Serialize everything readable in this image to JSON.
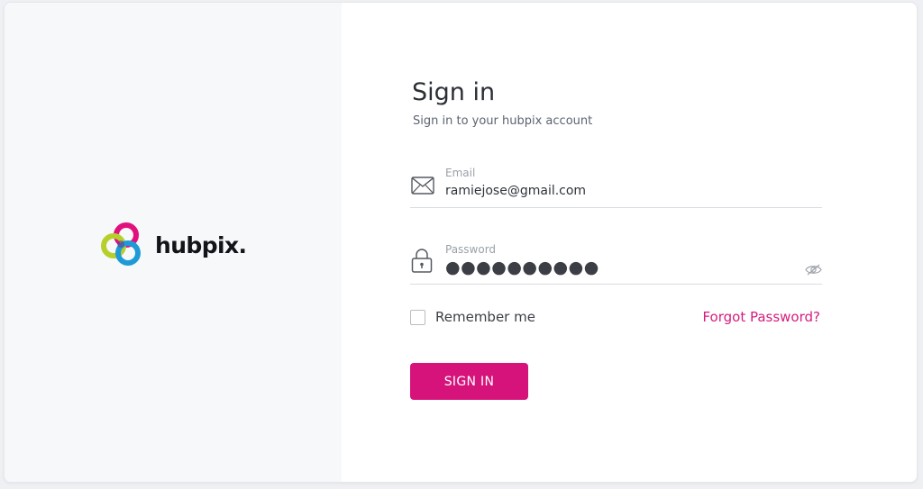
{
  "brand": {
    "name": "hubpix.",
    "logo_colors": [
      "#e0117f",
      "#b7cf2a",
      "#1e9bd7"
    ]
  },
  "form": {
    "title": "Sign in",
    "subtitle": "Sign in to your hubpix account",
    "email": {
      "label": "Email",
      "value": "ramiejose@gmail.com",
      "icon": "envelope-icon"
    },
    "password": {
      "label": "Password",
      "value": "●●●●●●●●●●",
      "icon": "lock-icon",
      "toggle_icon": "eye-icon"
    },
    "remember_label": "Remember me",
    "remember_checked": false,
    "forgot_label": "Forgot Password?",
    "submit_label": "SIGN IN"
  },
  "colors": {
    "accent": "#d6137a",
    "panel_bg": "#f7f8fa"
  }
}
